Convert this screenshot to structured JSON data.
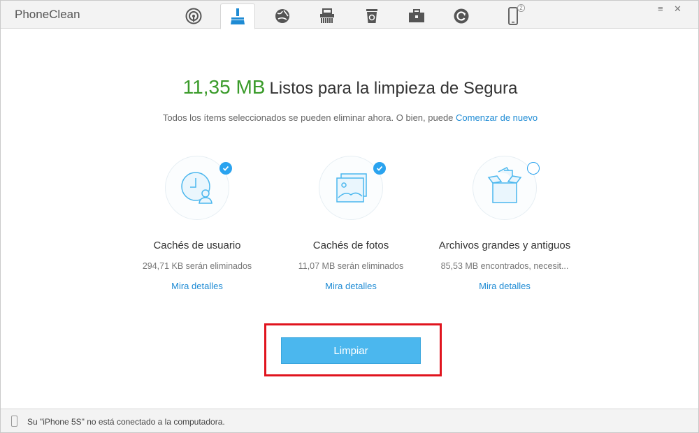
{
  "app": {
    "title": "PhoneClean"
  },
  "toolbar": {
    "tools": [
      {
        "icon": "radar-icon"
      },
      {
        "icon": "broom-icon",
        "active": true
      },
      {
        "icon": "globe-icon"
      },
      {
        "icon": "shredder-icon"
      },
      {
        "icon": "recycle-bin-icon"
      },
      {
        "icon": "toolbox-icon"
      },
      {
        "icon": "restore-icon"
      },
      {
        "icon": "phone-icon",
        "badge": "2"
      }
    ],
    "menu_glyph": "≡",
    "close_glyph": "✕"
  },
  "main": {
    "size": "11,35 MB",
    "headline": "Listos para la limpieza de Segura",
    "subline": "Todos los ítems seleccionados se pueden eliminar ahora. O bien, puede",
    "restart_link": "Comenzar de nuevo",
    "categories": [
      {
        "title": "Cachés de usuario",
        "desc": "294,71 KB serán eliminados",
        "detail": "Mira detalles",
        "checked": true,
        "icon": "user-clock-icon"
      },
      {
        "title": "Cachés de fotos",
        "desc": "11,07 MB serán eliminados",
        "detail": "Mira detalles",
        "checked": true,
        "icon": "photos-icon"
      },
      {
        "title": "Archivos grandes y antiguos",
        "desc": "85,53 MB encontrados, necesit...",
        "detail": "Mira detalles",
        "checked": false,
        "icon": "box-files-icon"
      }
    ],
    "clean_button": "Limpiar"
  },
  "status": {
    "message": "Su \"iPhone 5S\" no está conectado a la computadora."
  },
  "colors": {
    "accent": "#4bb7ee",
    "size_green": "#3a9b2a",
    "link": "#1e8bd4",
    "highlight": "#e0141e"
  }
}
